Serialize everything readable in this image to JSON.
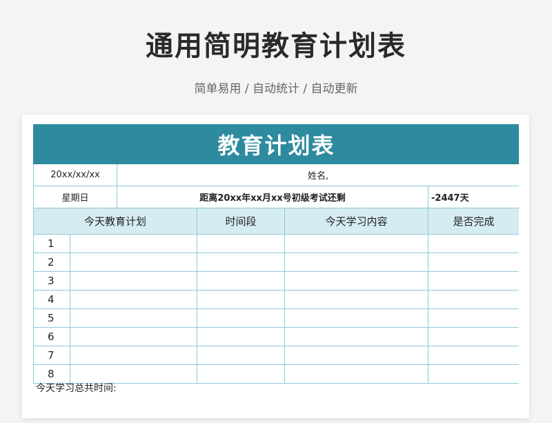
{
  "header": {
    "title": "通用简明教育计划表",
    "subtitle": "简单易用 / 自动统计 / 自动更新"
  },
  "sheet": {
    "banner": "教育计划表",
    "date": "20xx/xx/xx",
    "name_label": "姓名,",
    "weekday": "星期日",
    "countdown_text": "距离20xx年xx月xx号初级考试还剩",
    "countdown_value": "-2447天",
    "columns": [
      "今天教育计划",
      "时间段",
      "今天学习内容",
      "是否完成"
    ],
    "rows": [
      "1",
      "2",
      "3",
      "4",
      "5",
      "6",
      "7",
      "8"
    ],
    "footer": "今天学习总共时间:"
  }
}
